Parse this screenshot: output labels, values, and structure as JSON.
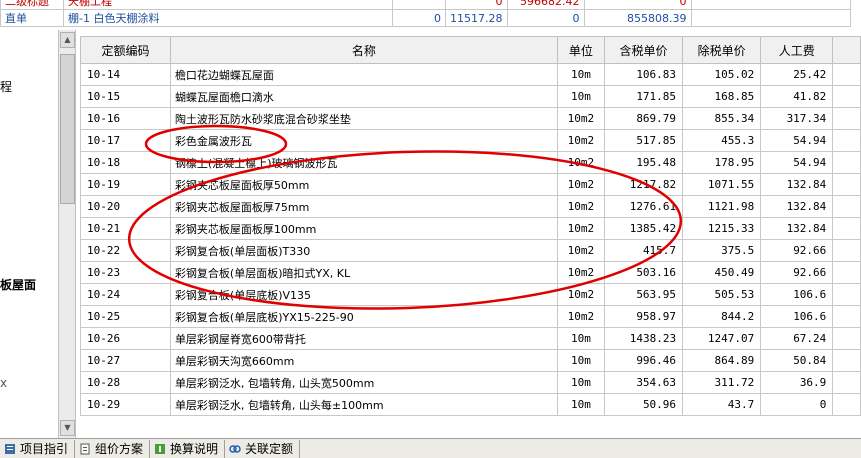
{
  "top_strip": {
    "row1": [
      "二级标题",
      "天棚工程",
      "",
      "0",
      "596682.42",
      "0",
      ""
    ],
    "row2": [
      "直单",
      "棚-1 白色天棚涂料",
      "0",
      "11517.28",
      "0",
      "855808.39",
      ""
    ]
  },
  "left_pane": {
    "labels": [
      "程",
      "板屋面",
      "x"
    ]
  },
  "grid": {
    "headers": [
      "定额编码",
      "名称",
      "单位",
      "含税单价",
      "除税单价",
      "人工费",
      ""
    ],
    "rows": [
      {
        "code": "10-14",
        "name": "檐口花边蝴蝶瓦屋面",
        "unit": "10m",
        "tax_price": "106.83",
        "notax_price": "105.02",
        "labor": "25.42"
      },
      {
        "code": "10-15",
        "name": "蝴蝶瓦屋面檐口滴水",
        "unit": "10m",
        "tax_price": "171.85",
        "notax_price": "168.85",
        "labor": "41.82"
      },
      {
        "code": "10-16",
        "name": "陶土波形瓦防水砂浆底混合砂浆坐垫",
        "unit": "10m2",
        "tax_price": "869.79",
        "notax_price": "855.34",
        "labor": "317.34"
      },
      {
        "code": "10-17",
        "name": "彩色金属波形瓦",
        "unit": "10m2",
        "tax_price": "517.85",
        "notax_price": "455.3",
        "labor": "54.94"
      },
      {
        "code": "10-18",
        "name": "钢檩上(混凝土檩上)玻璃钢波形瓦",
        "unit": "10m2",
        "tax_price": "195.48",
        "notax_price": "178.95",
        "labor": "54.94"
      },
      {
        "code": "10-19",
        "name": "彩钢夹芯板屋面板厚50mm",
        "unit": "10m2",
        "tax_price": "1217.82",
        "notax_price": "1071.55",
        "labor": "132.84"
      },
      {
        "code": "10-20",
        "name": "彩钢夹芯板屋面板厚75mm",
        "unit": "10m2",
        "tax_price": "1276.61",
        "notax_price": "1121.98",
        "labor": "132.84"
      },
      {
        "code": "10-21",
        "name": "彩钢夹芯板屋面板厚100mm",
        "unit": "10m2",
        "tax_price": "1385.42",
        "notax_price": "1215.33",
        "labor": "132.84"
      },
      {
        "code": "10-22",
        "name": "彩钢复合板(单层面板)T330",
        "unit": "10m2",
        "tax_price": "415.7",
        "notax_price": "375.5",
        "labor": "92.66"
      },
      {
        "code": "10-23",
        "name": "彩钢复合板(单层面板)暗扣式YX, KL",
        "unit": "10m2",
        "tax_price": "503.16",
        "notax_price": "450.49",
        "labor": "92.66"
      },
      {
        "code": "10-24",
        "name": "彩钢复合板(单层底板)V135",
        "unit": "10m2",
        "tax_price": "563.95",
        "notax_price": "505.53",
        "labor": "106.6"
      },
      {
        "code": "10-25",
        "name": "彩钢复合板(单层底板)YX15-225-90",
        "unit": "10m2",
        "tax_price": "958.97",
        "notax_price": "844.2",
        "labor": "106.6"
      },
      {
        "code": "10-26",
        "name": "单层彩钢屋脊宽600带背托",
        "unit": "10m",
        "tax_price": "1438.23",
        "notax_price": "1247.07",
        "labor": "67.24"
      },
      {
        "code": "10-27",
        "name": "单层彩钢天沟宽660mm",
        "unit": "10m",
        "tax_price": "996.46",
        "notax_price": "864.89",
        "labor": "50.84"
      },
      {
        "code": "10-28",
        "name": "单层彩钢泛水, 包墙转角, 山头宽500mm",
        "unit": "10m",
        "tax_price": "354.63",
        "notax_price": "311.72",
        "labor": "36.9"
      },
      {
        "code": "10-29",
        "name": "单层彩钢泛水, 包墙转角, 山头每±100mm",
        "unit": "10m",
        "tax_price": "50.96",
        "notax_price": "43.7",
        "labor": "0"
      }
    ]
  },
  "bottom_tabs": [
    {
      "label": "项目指引",
      "icon": "book-icon"
    },
    {
      "label": "组价方案",
      "icon": "document-icon"
    },
    {
      "label": "换算说明",
      "icon": "info-icon"
    },
    {
      "label": "关联定额",
      "icon": "link-icon"
    }
  ],
  "colors": {
    "annotation": "#e00000",
    "header_bg": "#f0f0f0",
    "top_text": "#c00000"
  }
}
